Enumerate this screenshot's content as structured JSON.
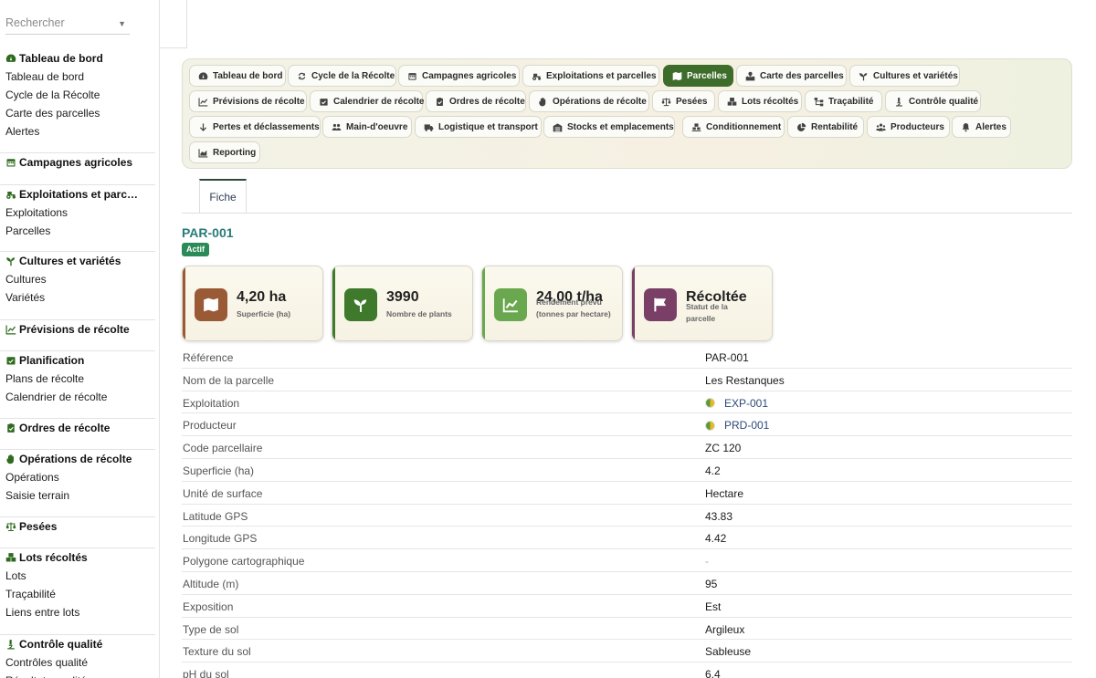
{
  "search": {
    "placeholder": "Rechercher"
  },
  "sidebar": {
    "sections": [
      {
        "title": "Tableau de bord",
        "icon": "dashboard-icon",
        "items": [
          "Tableau de bord",
          "Cycle de la Récolte",
          "Carte des parcelles",
          "Alertes"
        ]
      },
      {
        "title": "Campagnes agricoles",
        "icon": "calendar-icon",
        "items": []
      },
      {
        "title": "Exploitations et parc…",
        "icon": "tractor-icon",
        "items": [
          "Exploitations",
          "Parcelles"
        ]
      },
      {
        "title": "Cultures et variétés",
        "icon": "seedling-icon",
        "items": [
          "Cultures",
          "Variétés"
        ]
      },
      {
        "title": "Prévisions de récolte",
        "icon": "chart-line-icon",
        "items": []
      },
      {
        "title": "Planification",
        "icon": "calendar-check-icon",
        "items": [
          "Plans de récolte",
          "Calendrier de récolte"
        ]
      },
      {
        "title": "Ordres de récolte",
        "icon": "clipboard-check-icon",
        "items": []
      },
      {
        "title": "Opérations de récolte",
        "icon": "hand-icon",
        "items": [
          "Opérations",
          "Saisie terrain"
        ]
      },
      {
        "title": "Pesées",
        "icon": "scale-icon",
        "items": []
      },
      {
        "title": "Lots récoltés",
        "icon": "boxes-icon",
        "items": [
          "Lots",
          "Traçabilité",
          "Liens entre lots"
        ]
      },
      {
        "title": "Contrôle qualité",
        "icon": "microscope-icon",
        "items": [
          "Contrôles qualité",
          "Résultats qualité"
        ]
      }
    ]
  },
  "tabs": [
    {
      "label": "Tableau de bord",
      "icon": "dashboard-icon"
    },
    {
      "label": "Cycle de la Récolte",
      "icon": "refresh-icon"
    },
    {
      "label": "Campagnes agricoles",
      "icon": "calendar-icon"
    },
    {
      "label": "Exploitations et parcelles",
      "icon": "tractor-icon"
    },
    {
      "label": "Parcelles",
      "icon": "map-icon",
      "active": true
    },
    {
      "label": "Carte des parcelles",
      "icon": "map-marked-icon"
    },
    {
      "label": "Cultures et variétés",
      "icon": "seedling-icon"
    },
    {
      "label": "Prévisions de récolte",
      "icon": "chart-line-icon"
    },
    {
      "label": "Calendrier de récolte",
      "icon": "calendar-check-icon"
    },
    {
      "label": "Ordres de récolte",
      "icon": "clipboard-check-icon"
    },
    {
      "label": "Opérations de récolte",
      "icon": "hand-icon"
    },
    {
      "label": "Pesées",
      "icon": "scale-icon"
    },
    {
      "label": "Lots récoltés",
      "icon": "boxes-icon"
    },
    {
      "label": "Traçabilité",
      "icon": "sitemap-icon"
    },
    {
      "label": "Contrôle qualité",
      "icon": "microscope-icon"
    },
    {
      "label": "Pertes et déclassements",
      "icon": "arrow-down-icon"
    },
    {
      "label": "Main-d'oeuvre",
      "icon": "users-icon"
    },
    {
      "label": "Logistique et transport",
      "icon": "truck-icon"
    },
    {
      "label": "Stocks et emplacements",
      "icon": "warehouse-icon"
    },
    {
      "label": "Conditionnement",
      "icon": "pallet-icon"
    },
    {
      "label": "Rentabilité",
      "icon": "pie-chart-icon"
    },
    {
      "label": "Producteurs",
      "icon": "user-group-icon"
    },
    {
      "label": "Alertes",
      "icon": "bell-icon"
    },
    {
      "label": "Reporting",
      "icon": "chart-area-icon"
    }
  ],
  "view_tab": "Fiche",
  "record": {
    "title": "PAR-001",
    "status_badge": "Actif",
    "colors": {
      "title": "#2a7c76",
      "badge": "#2a8a58",
      "active_tab": "#3e6c2a"
    }
  },
  "stats": [
    {
      "value": "4,20 ha",
      "label": "Superficie (ha)",
      "icon": "map-icon",
      "color": "#9a5a35"
    },
    {
      "value": "3990",
      "label": "Nombre de plants",
      "icon": "seedling-icon",
      "color": "#3f7a2c"
    },
    {
      "value": "24,00 t/ha",
      "label": "Rendement prévu (tonnes par hectare)",
      "icon": "chart-line-icon",
      "color": "#6aa84f"
    },
    {
      "value": "Récoltée",
      "label": "Statut de la parcelle",
      "icon": "flag-icon",
      "color": "#7a3f66"
    }
  ],
  "fields": [
    {
      "label": "Référence",
      "value": "PAR-001"
    },
    {
      "label": "Nom de la parcelle",
      "value": "Les Restanques"
    },
    {
      "label": "Exploitation",
      "value": "EXP-001",
      "link": true
    },
    {
      "label": "Producteur",
      "value": "PRD-001",
      "link": true
    },
    {
      "label": "Code parcellaire",
      "value": "ZC 120"
    },
    {
      "label": "Superficie (ha)",
      "value": "4.2"
    },
    {
      "label": "Unité de surface",
      "value": "Hectare"
    },
    {
      "label": "Latitude GPS",
      "value": "43.83"
    },
    {
      "label": "Longitude GPS",
      "value": "4.42"
    },
    {
      "label": "Polygone cartographique",
      "value": "-",
      "dash": true
    },
    {
      "label": "Altitude (m)",
      "value": "95"
    },
    {
      "label": "Exposition",
      "value": "Est"
    },
    {
      "label": "Type de sol",
      "value": "Argileux"
    },
    {
      "label": "Texture du sol",
      "value": "Sableuse"
    },
    {
      "label": "pH du sol",
      "value": "6.4"
    }
  ]
}
